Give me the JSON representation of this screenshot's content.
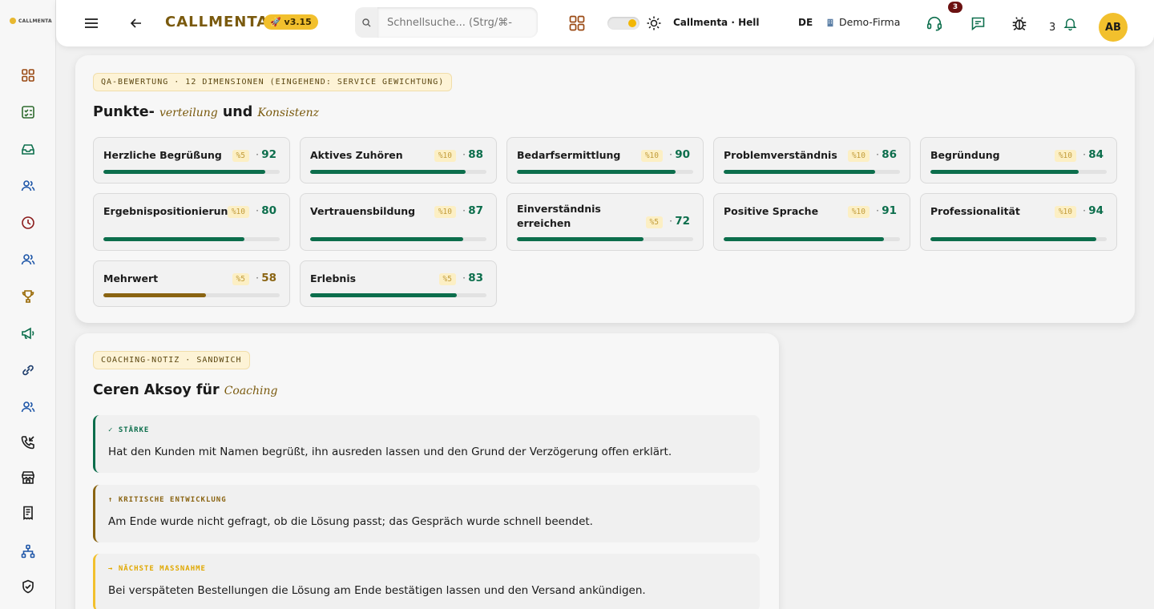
{
  "app": {
    "logo_text": "CALLMENTA",
    "brand": "CALLMENTA",
    "version": "🚀 v3.15",
    "theme_label": "Callmenta · Hell",
    "language": "DE",
    "company": "Demo-Firma",
    "headset_badge": "3",
    "notification_count": "3",
    "avatar_initials": "AB"
  },
  "search": {
    "placeholder": "Schnellsuche... (Strg/⌘-"
  },
  "sidebar": {
    "items": [
      {
        "icon": "dashboard-grid-icon"
      },
      {
        "icon": "checklist-icon"
      },
      {
        "icon": "inbox-icon"
      },
      {
        "icon": "users-icon"
      },
      {
        "icon": "clock-icon"
      },
      {
        "icon": "team-icon"
      },
      {
        "icon": "trophy-icon"
      },
      {
        "icon": "megaphone-icon"
      },
      {
        "icon": "integration-icon"
      },
      {
        "icon": "people-icon"
      },
      {
        "icon": "phone-incoming-icon"
      },
      {
        "icon": "store-icon"
      },
      {
        "icon": "receipt-icon"
      },
      {
        "icon": "org-chart-icon"
      },
      {
        "icon": "shield-check-icon"
      }
    ]
  },
  "qa": {
    "tag": "QA-BEWERTUNG · 12 DIMENSIONEN (EINGEHEND: SERVICE GEWICHTUNG)",
    "title_part1": "Punkte-",
    "title_accent1": "verteilung",
    "title_and": "und",
    "title_accent2": "Konsistenz",
    "dimensions": [
      {
        "name": "Herzliche Begrüßung",
        "weight": "%5",
        "score": "92",
        "value": 0.92
      },
      {
        "name": "Aktives Zuhören",
        "weight": "%10",
        "score": "88",
        "value": 0.88
      },
      {
        "name": "Bedarfsermittlung",
        "weight": "%10",
        "score": "90",
        "value": 0.9
      },
      {
        "name": "Problemverständnis",
        "weight": "%10",
        "score": "86",
        "value": 0.86
      },
      {
        "name": "Begründung",
        "weight": "%10",
        "score": "84",
        "value": 0.84
      },
      {
        "name": "Ergebnispositionierung",
        "weight": "%10",
        "score": "80",
        "value": 0.8
      },
      {
        "name": "Vertrauensbildung",
        "weight": "%10",
        "score": "87",
        "value": 0.87
      },
      {
        "name": "Einverständnis erreichen",
        "weight": "%5",
        "score": "72",
        "value": 0.72
      },
      {
        "name": "Positive Sprache",
        "weight": "%10",
        "score": "91",
        "value": 0.91
      },
      {
        "name": "Professionalität",
        "weight": "%10",
        "score": "94",
        "value": 0.94
      },
      {
        "name": "Mehrwert",
        "weight": "%5",
        "score": "58",
        "value": 0.58
      },
      {
        "name": "Erlebnis",
        "weight": "%5",
        "score": "83",
        "value": 0.83
      }
    ]
  },
  "coaching": {
    "tag": "COACHING-NOTIZ · SANDWICH",
    "title": "Ceren Aksoy für",
    "title_accent": "Coaching",
    "notes": [
      {
        "label": "✓ STÄRKE",
        "text": "Hat den Kunden mit Namen begrüßt, ihn ausreden lassen und den Grund der Verzögerung offen erklärt."
      },
      {
        "label": "↑ KRITISCHE ENTWICKLUNG",
        "text": "Am Ende wurde nicht gefragt, ob die Lösung passt; das Gespräch wurde schnell beendet."
      },
      {
        "label": "→ NÄCHSTE MASSNAHME",
        "text": "Bei verspäteten Bestellungen die Lösung am Ende bestätigen lassen und den Versand ankündigen."
      }
    ]
  },
  "colors": {
    "brand": "#7a5a0e",
    "accent_yellow": "#f2c02d",
    "score_good": "#0c6e4c",
    "score_mid": "#8a6412"
  }
}
